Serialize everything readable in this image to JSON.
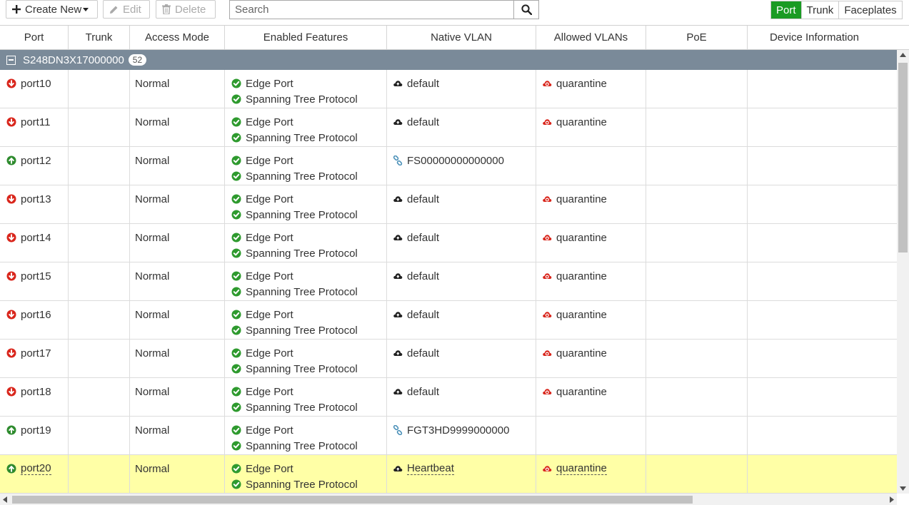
{
  "toolbar": {
    "create_new_label": "Create New",
    "edit_label": "Edit",
    "delete_label": "Delete",
    "search_placeholder": "Search",
    "views": [
      "Port",
      "Trunk",
      "Faceplates"
    ],
    "active_view": "Port"
  },
  "columns": [
    "Port",
    "Trunk",
    "Access Mode",
    "Enabled Features",
    "Native VLAN",
    "Allowed VLANs",
    "PoE",
    "Device Information"
  ],
  "group": {
    "name": "S248DN3X17000000",
    "count": "52"
  },
  "rows": [
    {
      "port": "port10",
      "status": "down",
      "trunk": "",
      "access_mode": "Normal",
      "features": [
        "Edge Port",
        "Spanning Tree Protocol"
      ],
      "native_vlan": "default",
      "native_vlan_icon": "cloud-icon",
      "allowed_vlans": "quarantine",
      "poe": "",
      "device_info": ""
    },
    {
      "port": "port11",
      "status": "down",
      "trunk": "",
      "access_mode": "Normal",
      "features": [
        "Edge Port",
        "Spanning Tree Protocol"
      ],
      "native_vlan": "default",
      "native_vlan_icon": "cloud-icon",
      "allowed_vlans": "quarantine",
      "poe": "",
      "device_info": ""
    },
    {
      "port": "port12",
      "status": "up",
      "trunk": "",
      "access_mode": "Normal",
      "features": [
        "Edge Port",
        "Spanning Tree Protocol"
      ],
      "native_vlan": "FS00000000000000",
      "native_vlan_icon": "link-icon",
      "allowed_vlans": "",
      "poe": "",
      "device_info": ""
    },
    {
      "port": "port13",
      "status": "down",
      "trunk": "",
      "access_mode": "Normal",
      "features": [
        "Edge Port",
        "Spanning Tree Protocol"
      ],
      "native_vlan": "default",
      "native_vlan_icon": "cloud-icon",
      "allowed_vlans": "quarantine",
      "poe": "",
      "device_info": ""
    },
    {
      "port": "port14",
      "status": "down",
      "trunk": "",
      "access_mode": "Normal",
      "features": [
        "Edge Port",
        "Spanning Tree Protocol"
      ],
      "native_vlan": "default",
      "native_vlan_icon": "cloud-icon",
      "allowed_vlans": "quarantine",
      "poe": "",
      "device_info": ""
    },
    {
      "port": "port15",
      "status": "down",
      "trunk": "",
      "access_mode": "Normal",
      "features": [
        "Edge Port",
        "Spanning Tree Protocol"
      ],
      "native_vlan": "default",
      "native_vlan_icon": "cloud-icon",
      "allowed_vlans": "quarantine",
      "poe": "",
      "device_info": ""
    },
    {
      "port": "port16",
      "status": "down",
      "trunk": "",
      "access_mode": "Normal",
      "features": [
        "Edge Port",
        "Spanning Tree Protocol"
      ],
      "native_vlan": "default",
      "native_vlan_icon": "cloud-icon",
      "allowed_vlans": "quarantine",
      "poe": "",
      "device_info": ""
    },
    {
      "port": "port17",
      "status": "down",
      "trunk": "",
      "access_mode": "Normal",
      "features": [
        "Edge Port",
        "Spanning Tree Protocol"
      ],
      "native_vlan": "default",
      "native_vlan_icon": "cloud-icon",
      "allowed_vlans": "quarantine",
      "poe": "",
      "device_info": ""
    },
    {
      "port": "port18",
      "status": "down",
      "trunk": "",
      "access_mode": "Normal",
      "features": [
        "Edge Port",
        "Spanning Tree Protocol"
      ],
      "native_vlan": "default",
      "native_vlan_icon": "cloud-icon",
      "allowed_vlans": "quarantine",
      "poe": "",
      "device_info": ""
    },
    {
      "port": "port19",
      "status": "up",
      "trunk": "",
      "access_mode": "Normal",
      "features": [
        "Edge Port",
        "Spanning Tree Protocol"
      ],
      "native_vlan": "FGT3HD9999000000",
      "native_vlan_icon": "link-icon",
      "allowed_vlans": "",
      "poe": "",
      "device_info": ""
    },
    {
      "port": "port20",
      "status": "up",
      "trunk": "",
      "access_mode": "Normal",
      "features": [
        "Edge Port",
        "Spanning Tree Protocol"
      ],
      "native_vlan": "Heartbeat",
      "native_vlan_icon": "cloud-icon",
      "allowed_vlans": "quarantine",
      "poe": "",
      "device_info": "",
      "selected": true
    }
  ],
  "colors": {
    "up": "#2e8b2e",
    "down": "#d9261c",
    "feature_check": "#2e9a2e",
    "link": "#4a90b8",
    "group_bar": "#7a8a99",
    "active_view": "#1a9b23",
    "selected_row": "#ffffa6"
  }
}
